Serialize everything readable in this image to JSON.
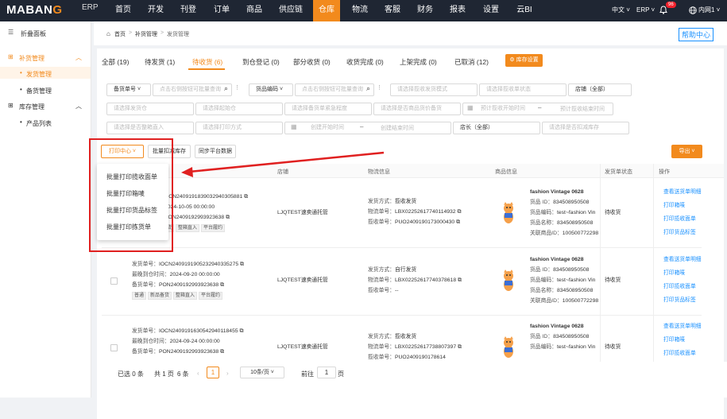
{
  "topbar": {
    "logo_left": "MABAN",
    "logo_g": "G",
    "erp": "ERP",
    "nav": [
      "首页",
      "开发",
      "刊登",
      "订单",
      "商品",
      "供应链",
      "仓库",
      "物流",
      "客服",
      "财务",
      "报表",
      "设置",
      "云BI"
    ],
    "lang": "中文 ˅",
    "erp_menu": "ERP ˅",
    "bell_badge": "96",
    "network": "内网1 ˅"
  },
  "sidebar": {
    "collapse": "折叠面板",
    "group1": "补货管理",
    "item1": "发货管理",
    "item2": "备货管理",
    "group2": "库存管理",
    "item3": "产品列表"
  },
  "breadcrumb": {
    "home": "首页",
    "b1": "补货管理",
    "b2": "发货管理"
  },
  "help": "帮助中心",
  "tabs": [
    "全部 (19)",
    "待发货 (1)",
    "待收货 (6)",
    "到仓登记 (0)",
    "部分收货 (0)",
    "收货完成 (0)",
    "上架完成 (0)",
    "已取消 (12)"
  ],
  "stock_settings": "库存设置",
  "filters": {
    "row1": {
      "f1": "备货单号 ˅",
      "f1b": "点击右侧按钮可批量查询",
      "f2": "货品编码 ˅",
      "f2b": "点击右侧按钮可批量查询",
      "f3": "请选择揽收发货模式",
      "f4": "请选择揽收单状态",
      "f5": "店铺（全部）"
    },
    "row2": {
      "f1": "请选择发货仓",
      "f2": "请选择起始仓",
      "f3": "请选择备货单紧急程度",
      "f4": "请选择是否商品货价备货",
      "f5": "预计揽收开始时间",
      "sep": "–",
      "f6": "预计揽收结束时间"
    },
    "row3": {
      "f1": "请选择是否整箱直入",
      "f2": "请选择打印方式",
      "f3": "创建开始时间",
      "sep": "–",
      "f4": "创建结束时间",
      "f5": "店长（全部）",
      "f6": "请选择是否扣减库存"
    }
  },
  "buttons": {
    "print": "打印中心 ˅",
    "batch_deduct": "批量扣减库存",
    "sync": "同步平台数据",
    "export": "导出 ˅"
  },
  "table_headers": {
    "shop": "店铺",
    "logistics": "物流信息",
    "goods": "商品信息",
    "status": "发货单状态",
    "ops": "操作"
  },
  "dropdown": [
    "批量打印揽收面单",
    "批量打印箱唛",
    "批量打印货品标签",
    "批量打印拣货单"
  ],
  "rows": [
    {
      "order_suffix": "OCN2409191839032940305881",
      "date_suffix": "2024-10-05 00:00:00",
      "po_suffix": "PON2409192993923638",
      "tags": [
        "货",
        "整箱直入",
        "平台履约"
      ],
      "shop": "LJQTEST速卖通托管",
      "ship_method": "揽收发货",
      "tracking": "LBX02252617740114932",
      "pickup": "PUO2409190173000430",
      "product": "fashion Vintage 0628",
      "goods_id": "834508950508",
      "goods_code": "test~fashion Vin",
      "goods_name": "834508950508",
      "related": "100500772298",
      "status": "待收货",
      "ops": [
        "查看送货单明细",
        "打印箱唛",
        "打印揽收面单",
        "打印货品标签"
      ]
    },
    {
      "order": "IOCN2409191905232940335275",
      "date": "2024-09-20 00:00:00",
      "po": "PON2409192993923638",
      "tags": [
        "普通",
        "新品备货",
        "整箱直入",
        "平台履约"
      ],
      "shop": "LJQTEST速卖通托管",
      "ship_method": "自行发货",
      "tracking": "LBX02252617740378618",
      "pickup": "--",
      "product": "fashion Vintage 0628",
      "goods_id": "834508950508",
      "goods_code": "test~fashion Vin",
      "goods_name": "834508950508",
      "related": "100500772298",
      "status": "待收货",
      "ops": [
        "查看送货单明细",
        "打印箱唛",
        "打印揽收面单",
        "打印货品标签"
      ]
    },
    {
      "order": "IOCN2409191630542940118455",
      "date": "2024-09-24 00:00:00",
      "po": "PON2409192993923638",
      "shop": "LJQTEST速卖通托管",
      "ship_method": "揽收发货",
      "tracking": "LBX02252617738807397",
      "pickup": "PUO2409190178614",
      "product": "fashion Vintage 0628",
      "goods_id": "834508950508",
      "goods_code": "test~fashion Vin",
      "status": "待收货",
      "ops": [
        "查看送货单明细",
        "打印箱唛",
        "打印揽收面单"
      ]
    }
  ],
  "labels": {
    "order": "发货单号：",
    "date": "最晚到仓时间：",
    "po": "备货单号：",
    "ship_method": "发货方式：",
    "tracking": "物流单号：",
    "pickup": "揽收单号：",
    "goods_id": "货品 ID：",
    "goods_code": "货品编码：",
    "goods_name": "货品名称：",
    "related": "关联商品ID："
  },
  "footer": {
    "selected": "已选 0 条",
    "total": "共 1 页",
    "count": "6 条",
    "page": "1",
    "page_size": "10条/页 ˅",
    "goto": "前往",
    "goto_page": "1",
    "page_unit": "页"
  }
}
